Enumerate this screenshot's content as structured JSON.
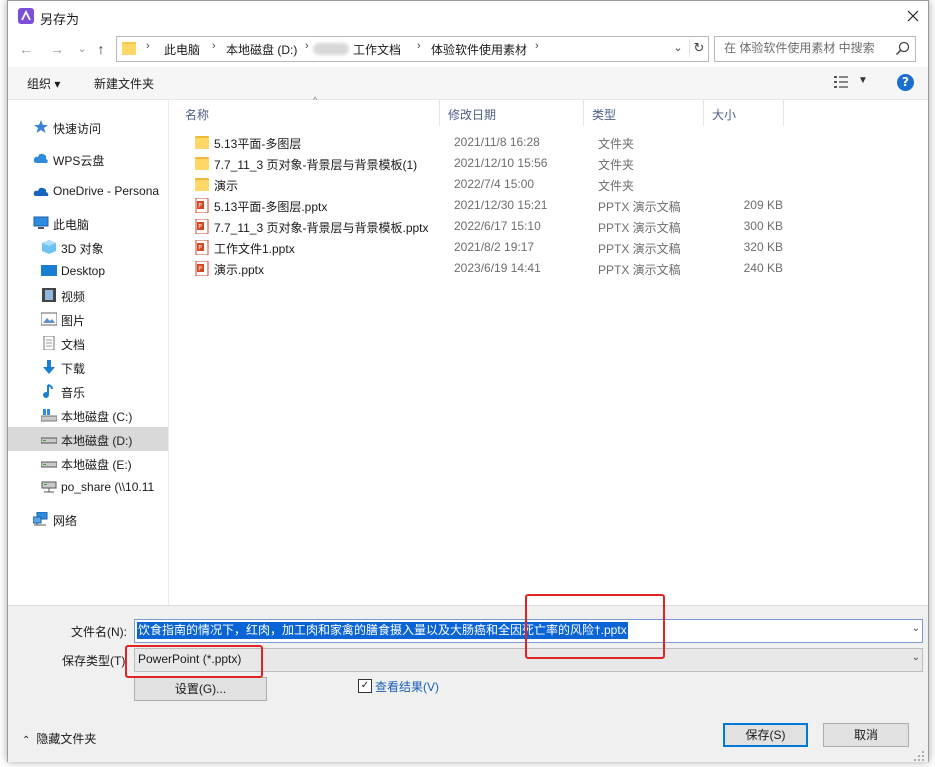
{
  "window": {
    "title": "另存为"
  },
  "nav_buttons": {
    "back": "←",
    "forward": "→",
    "recent": "⌄",
    "up": "↑"
  },
  "breadcrumb": {
    "segments": [
      "此电脑",
      "本地磁盘 (D:)",
      "工作文档",
      "体验软件使用素材"
    ]
  },
  "search": {
    "placeholder": "在 体验软件使用素材 中搜索"
  },
  "toolbar": {
    "organize": "组织 ▾",
    "new_folder": "新建文件夹"
  },
  "sidebar": {
    "items": [
      {
        "label": "快速访问",
        "icon": "star-icon"
      },
      {
        "label": "WPS云盘",
        "icon": "cloud-icon"
      },
      {
        "label": "OneDrive - Persona",
        "icon": "onedrive-icon"
      },
      {
        "label": "此电脑",
        "icon": "computer-icon"
      },
      {
        "label": "3D 对象",
        "icon": "cube-icon"
      },
      {
        "label": "Desktop",
        "icon": "desktop-icon"
      },
      {
        "label": "视频",
        "icon": "video-icon"
      },
      {
        "label": "图片",
        "icon": "picture-icon"
      },
      {
        "label": "文档",
        "icon": "document-icon"
      },
      {
        "label": "下载",
        "icon": "download-icon"
      },
      {
        "label": "音乐",
        "icon": "music-icon"
      },
      {
        "label": "本地磁盘 (C:)",
        "icon": "drive-icon"
      },
      {
        "label": "本地磁盘 (D:)",
        "icon": "drive-icon",
        "selected": true
      },
      {
        "label": "本地磁盘 (E:)",
        "icon": "drive-icon"
      },
      {
        "label": "po_share (\\\\10.11",
        "icon": "network-drive-icon"
      },
      {
        "label": "网络",
        "icon": "network-icon"
      }
    ]
  },
  "columns": {
    "name": "名称",
    "date": "修改日期",
    "type": "类型",
    "size": "大小"
  },
  "files": [
    {
      "name": "5.13平面-多图层",
      "date": "2021/11/8 16:28",
      "type": "文件夹",
      "size": "",
      "kind": "folder"
    },
    {
      "name": "7.7_11_3 页对象-背景层与背景模板(1)",
      "date": "2021/12/10 15:56",
      "type": "文件夹",
      "size": "",
      "kind": "folder"
    },
    {
      "name": "演示",
      "date": "2022/7/4 15:00",
      "type": "文件夹",
      "size": "",
      "kind": "folder"
    },
    {
      "name": "5.13平面-多图层.pptx",
      "date": "2021/12/30 15:21",
      "type": "PPTX 演示文稿",
      "size": "209 KB",
      "kind": "pptx"
    },
    {
      "name": "7.7_11_3 页对象-背景层与背景模板.pptx",
      "date": "2022/6/17 15:10",
      "type": "PPTX 演示文稿",
      "size": "300 KB",
      "kind": "pptx"
    },
    {
      "name": "工作文件1.pptx",
      "date": "2021/8/2 19:17",
      "type": "PPTX 演示文稿",
      "size": "320 KB",
      "kind": "pptx"
    },
    {
      "name": "演示.pptx",
      "date": "2023/6/19 14:41",
      "type": "PPTX 演示文稿",
      "size": "240 KB",
      "kind": "pptx"
    }
  ],
  "form": {
    "filename_label": "文件名(N):",
    "filename_value": "饮食指南的情况下，红肉，加工肉和家禽的膳食摄入量以及大肠癌和全因死亡率的风险†.pptx",
    "filetype_label": "保存类型(T)",
    "filetype_value": "PowerPoint (*.pptx)",
    "settings_button": "设置(G)...",
    "view_results_label": "查看结果(V)",
    "view_results_checked": true,
    "hide_folders": "隐藏文件夹",
    "save_button": "保存(S)",
    "cancel_button": "取消"
  },
  "colors": {
    "selection": "#0a64d6",
    "annotation_red": "#e02424",
    "link_blue": "#1a5fb4",
    "help_blue": "#1a6fd0"
  }
}
